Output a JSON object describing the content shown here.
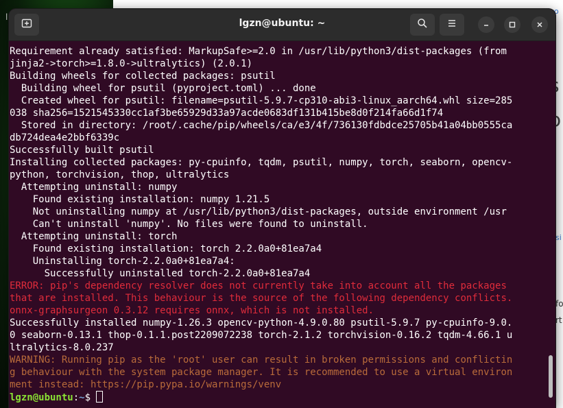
{
  "window": {
    "title": "lgzn@ubuntu: ~"
  },
  "background_app": {
    "fragments": [
      "l",
      "dco",
      "s",
      "o",
      "si",
      "fo",
      "rt"
    ]
  },
  "terminal": {
    "lines": [
      {
        "text": "Requirement already satisfied: MarkupSafe>=2.0 in /usr/lib/python3/dist-packages (from",
        "style": "normal"
      },
      {
        "text": "jinja2->torch>=1.8.0->ultralytics) (2.0.1)",
        "style": "normal"
      },
      {
        "text": "Building wheels for collected packages: psutil",
        "style": "normal"
      },
      {
        "text": "  Building wheel for psutil (pyproject.toml) ... done",
        "style": "normal"
      },
      {
        "text": "  Created wheel for psutil: filename=psutil-5.9.7-cp310-abi3-linux_aarch64.whl size=285",
        "style": "normal"
      },
      {
        "text": "038 sha256=1521545330cc1af3be65929d33a97acde0683df131b415be8d0f214fa66d1f74",
        "style": "normal"
      },
      {
        "text": "  Stored in directory: /root/.cache/pip/wheels/ca/e3/4f/736130fdbdce25705b41a04bb0555ca",
        "style": "normal"
      },
      {
        "text": "db724dea4e2bbf6339c",
        "style": "normal"
      },
      {
        "text": "Successfully built psutil",
        "style": "normal"
      },
      {
        "text": "Installing collected packages: py-cpuinfo, tqdm, psutil, numpy, torch, seaborn, opencv-",
        "style": "normal"
      },
      {
        "text": "python, torchvision, thop, ultralytics",
        "style": "normal"
      },
      {
        "text": "  Attempting uninstall: numpy",
        "style": "normal"
      },
      {
        "text": "    Found existing installation: numpy 1.21.5",
        "style": "normal"
      },
      {
        "text": "    Not uninstalling numpy at /usr/lib/python3/dist-packages, outside environment /usr",
        "style": "normal"
      },
      {
        "text": "    Can't uninstall 'numpy'. No files were found to uninstall.",
        "style": "normal"
      },
      {
        "text": "  Attempting uninstall: torch",
        "style": "normal"
      },
      {
        "text": "    Found existing installation: torch 2.2.0a0+81ea7a4",
        "style": "normal"
      },
      {
        "text": "    Uninstalling torch-2.2.0a0+81ea7a4:",
        "style": "normal"
      },
      {
        "text": "      Successfully uninstalled torch-2.2.0a0+81ea7a4",
        "style": "normal"
      },
      {
        "text": "ERROR: pip's dependency resolver does not currently take into account all the packages",
        "style": "err"
      },
      {
        "text": "that are installed. This behaviour is the source of the following dependency conflicts.",
        "style": "err"
      },
      {
        "text": "onnx-graphsurgeon 0.3.12 requires onnx, which is not installed.",
        "style": "err"
      },
      {
        "text": "Successfully installed numpy-1.26.3 opencv-python-4.9.0.80 psutil-5.9.7 py-cpuinfo-9.0.",
        "style": "normal"
      },
      {
        "text": "0 seaborn-0.13.1 thop-0.1.1.post2209072238 torch-2.1.2 torchvision-0.16.2 tqdm-4.66.1 u",
        "style": "normal"
      },
      {
        "text": "ltralytics-8.0.237",
        "style": "normal"
      },
      {
        "text": "WARNING: Running pip as the 'root' user can result in broken permissions and conflictin",
        "style": "warn"
      },
      {
        "text": "g behaviour with the system package manager. It is recommended to use a virtual environ",
        "style": "warn"
      },
      {
        "text": "ment instead: https://pip.pypa.io/warnings/venv",
        "style": "warn"
      }
    ],
    "prompt": {
      "user_host": "lgzn@ubuntu",
      "separator": ":",
      "path": "~",
      "symbol": "$ "
    }
  },
  "icons": {
    "new_tab": "new-tab-icon",
    "search": "search-icon",
    "menu": "hamburger-menu-icon",
    "minimize": "minimize-icon",
    "maximize": "maximize-icon",
    "close": "close-icon"
  },
  "colors": {
    "terminal_bg": "#300a24",
    "error": "#e02c3b",
    "warning": "#b96b3a",
    "prompt_user": "#8ae234",
    "prompt_path": "#729fcf"
  }
}
